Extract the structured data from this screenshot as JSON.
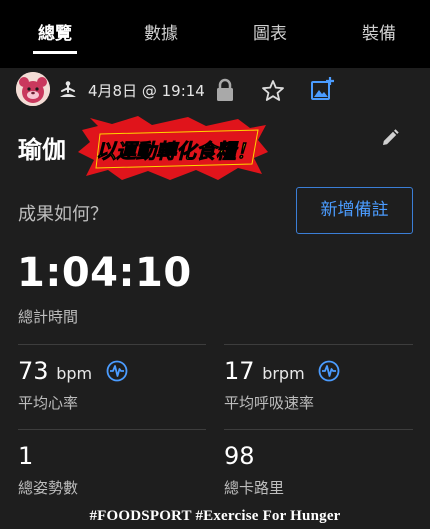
{
  "tabs": [
    {
      "label": "總覽",
      "active": true
    },
    {
      "label": "數據",
      "active": false
    },
    {
      "label": "圖表",
      "active": false
    },
    {
      "label": "裝備",
      "active": false
    }
  ],
  "header": {
    "date_time": "4月8日 @ 19:14",
    "icons": [
      "avatar",
      "yoga-icon",
      "lock-icon",
      "star-icon",
      "add-photo-icon"
    ]
  },
  "activity": {
    "title": "瑜伽",
    "banner_text": "以運動轉化食糧！"
  },
  "outcome": {
    "prompt": "成果如何？",
    "add_note_label": "新增備註"
  },
  "total_time": {
    "value": "1:04:10",
    "label": "總計時間"
  },
  "stats": {
    "avg_hr": {
      "value": "73",
      "unit": "bpm",
      "label": "平均心率"
    },
    "avg_resp": {
      "value": "17",
      "unit": "brpm",
      "label": "平均呼吸速率"
    },
    "poses": {
      "value": "1",
      "label": "總姿勢數"
    },
    "calories": {
      "value": "98",
      "label": "總卡路里"
    }
  },
  "footer": "#FOODSPORT #Exercise For Hunger",
  "colors": {
    "accent_blue": "#4b9cff",
    "background": "#1e1e1e",
    "tabbar": "#000000",
    "banner_red": "#e0141b",
    "banner_yellow": "#ffd400"
  }
}
